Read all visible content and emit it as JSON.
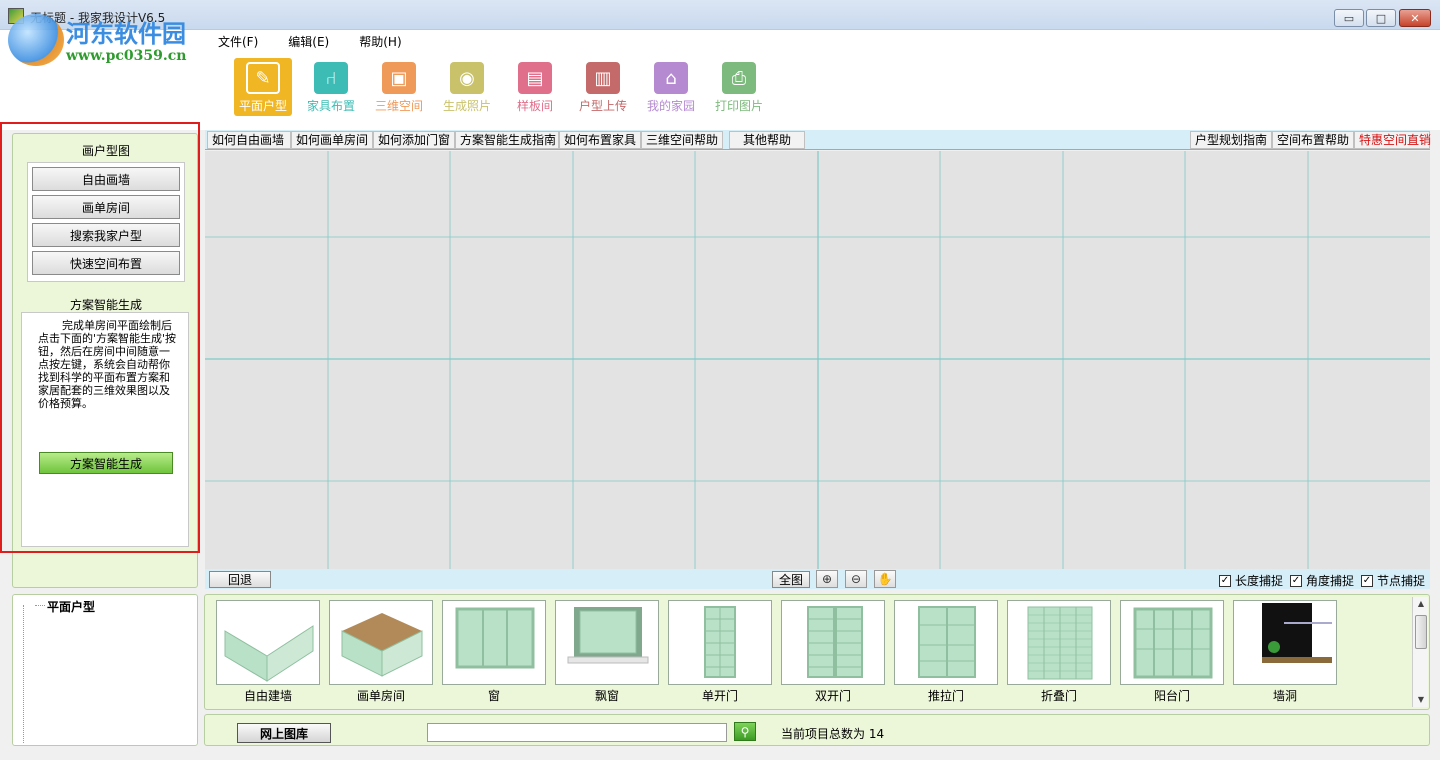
{
  "window": {
    "title": "无标题 - 我家我设计V6.5",
    "watermark_cn": "河东软件园",
    "watermark_url": "www.pc0359.cn",
    "min_label": "▭",
    "max_label": "□",
    "close_label": "✕"
  },
  "menu": [
    "文件(F)",
    "编辑(E)",
    "帮助(H)"
  ],
  "toolbar": [
    {
      "label": "平面户型",
      "icon": "pencil-icon",
      "color": "#f0b623",
      "active": true
    },
    {
      "label": "家具布置",
      "icon": "chair-icon",
      "color": "#3dbcb5"
    },
    {
      "label": "三维空间",
      "icon": "cube-icon",
      "color": "#f09a5a"
    },
    {
      "label": "生成照片",
      "icon": "camera-icon",
      "color": "#c9c26a"
    },
    {
      "label": "样板间",
      "icon": "room-icon",
      "color": "#e06f8b"
    },
    {
      "label": "户型上传",
      "icon": "floppy-icon",
      "color": "#c46a6a"
    },
    {
      "label": "我的家园",
      "icon": "house-icon",
      "color": "#b58ad0"
    },
    {
      "label": "打印图片",
      "icon": "printer-icon",
      "color": "#7dba7d"
    }
  ],
  "left_panel": {
    "title": "画户型图",
    "buttons": [
      "自由画墙",
      "画单房间",
      "搜索我家户型",
      "快速空间布置"
    ],
    "sub_title": "方案智能生成",
    "description": "完成单房间平面绘制后点击下面的'方案智能生成'按钮，然后在房间中间随意一点按左键，系统会自动帮你找到科学的平面布置方案和家居配套的三维效果图以及价格预算。",
    "generate_button": "方案智能生成"
  },
  "help_tabs_left": [
    "如何自由画墙",
    "如何画单房间",
    "如何添加门窗",
    "方案智能生成指南",
    "如何布置家具",
    "三维空间帮助",
    "其他帮助"
  ],
  "help_tabs_right": [
    {
      "label": "户型规划指南",
      "red": false
    },
    {
      "label": "空间布置帮助",
      "red": false
    },
    {
      "label": "特惠空间直销",
      "red": true
    }
  ],
  "status": {
    "undo": "回退",
    "fit": "全图",
    "checks": [
      {
        "label": "长度捕捉",
        "checked": true
      },
      {
        "label": "角度捕捉",
        "checked": true
      },
      {
        "label": "节点捕捉",
        "checked": true
      }
    ]
  },
  "tree": {
    "root": "平面户型"
  },
  "catalog": [
    {
      "label": "自由建墙",
      "kind": "wall"
    },
    {
      "label": "画单房间",
      "kind": "room"
    },
    {
      "label": "窗",
      "kind": "window"
    },
    {
      "label": "飘窗",
      "kind": "baywindow"
    },
    {
      "label": "单开门",
      "kind": "door1"
    },
    {
      "label": "双开门",
      "kind": "door2"
    },
    {
      "label": "推拉门",
      "kind": "sliding"
    },
    {
      "label": "折叠门",
      "kind": "folding"
    },
    {
      "label": "阳台门",
      "kind": "balcony"
    },
    {
      "label": "墙洞",
      "kind": "hole"
    }
  ],
  "search": {
    "online_button": "网上图库",
    "placeholder": "",
    "total_label": "当前项目总数为 14"
  },
  "colors": {
    "grid": "#7fcac6",
    "canvas": "#e3e3e3",
    "accent_red": "#e01d1d"
  }
}
